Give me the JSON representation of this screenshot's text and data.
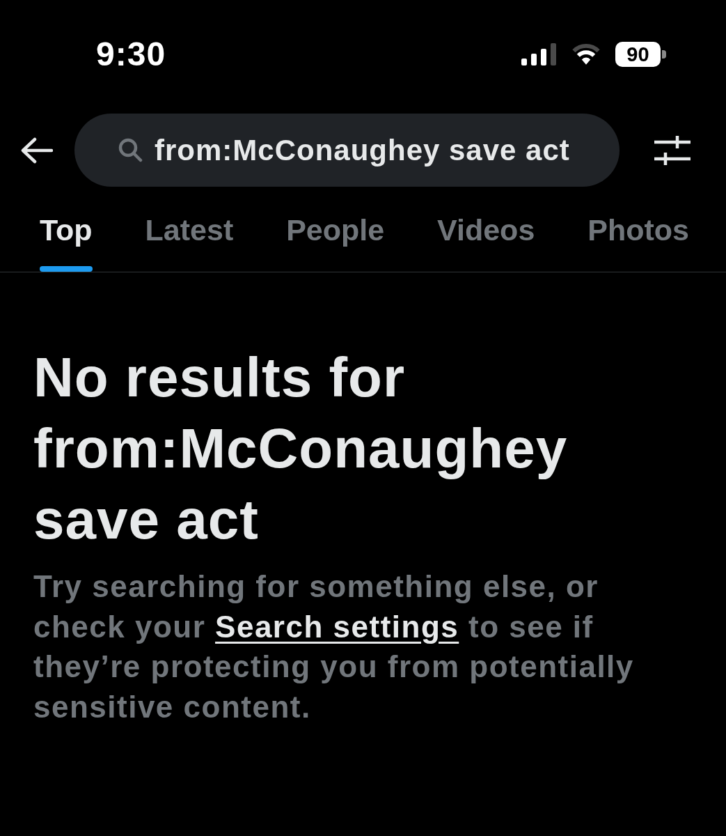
{
  "status_bar": {
    "time": "9:30",
    "battery": "90"
  },
  "search": {
    "value": "from:McConaughey save act"
  },
  "tabs": [
    {
      "label": "Top",
      "selected": true
    },
    {
      "label": "Latest",
      "selected": false
    },
    {
      "label": "People",
      "selected": false
    },
    {
      "label": "Videos",
      "selected": false
    },
    {
      "label": "Photos",
      "selected": false
    }
  ],
  "empty_state": {
    "heading": "No results for from:McConaughey save act",
    "message": {
      "before": "Try searching for something else, or check your ",
      "link": "Search settings",
      "after": " to see if they’re protecting you from potentially sensitive content."
    }
  }
}
